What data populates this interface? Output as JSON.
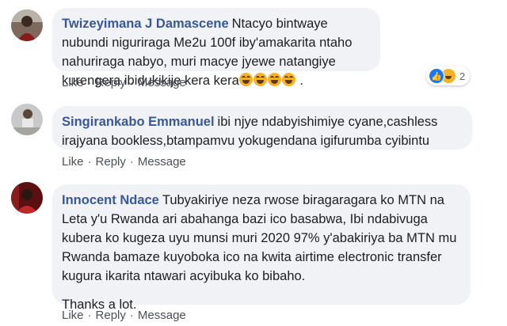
{
  "comments": [
    {
      "author": "Twizeyimana J Damascene",
      "text": "Ntacyo bintwaye nubundi niguriraga Me2u 100f iby'amakarita ntaho nahuriraga nabyo, muri macye jyewe natangiye kurengera ibidukikije kera kera",
      "emojis": [
        "laughing-tears-emoji",
        "laughing-tears-emoji",
        "laughing-tears-emoji",
        "laughing-tears-emoji"
      ],
      "trailing": " .",
      "actions": {
        "like": "Like",
        "reply": "Reply",
        "message": "Message",
        "sep": "·"
      },
      "reactions": {
        "types": [
          "like-icon",
          "haha-icon"
        ],
        "count": "2"
      }
    },
    {
      "author": "Singirankabo Emmanuel",
      "text": "ibi njye ndabyishimiye cyane,cashless irajyana bookless,btampamvu yokugendana igifurumba cyibintu",
      "actions": {
        "like": "Like",
        "reply": "Reply",
        "message": "Message",
        "sep": "·"
      }
    },
    {
      "author": "Innocent Ndace",
      "text": "Tubyakiriye neza rwose biragaragara ko MTN na Leta y'u Rwanda ari abahanga bazi ico basabwa, Ibi ndabivuga kubera ko kugeza uyu munsi muri 2020 97% y'abakiriya ba MTN mu Rwanda bamaze kuyoboka ico na kwita airtime electronic transfer kugura ikarita ntawari acyibuka ko bibaho.",
      "text2": "Thanks a lot.",
      "actions": {
        "like": "Like",
        "reply": "Reply",
        "message": "Message",
        "sep": "·"
      }
    }
  ],
  "colors": {
    "author": "#385898",
    "bubble": "#f0f2f5",
    "action": "#4b4f56",
    "like_blue": "#1877f2",
    "haha_yellow": "#f7b125"
  }
}
